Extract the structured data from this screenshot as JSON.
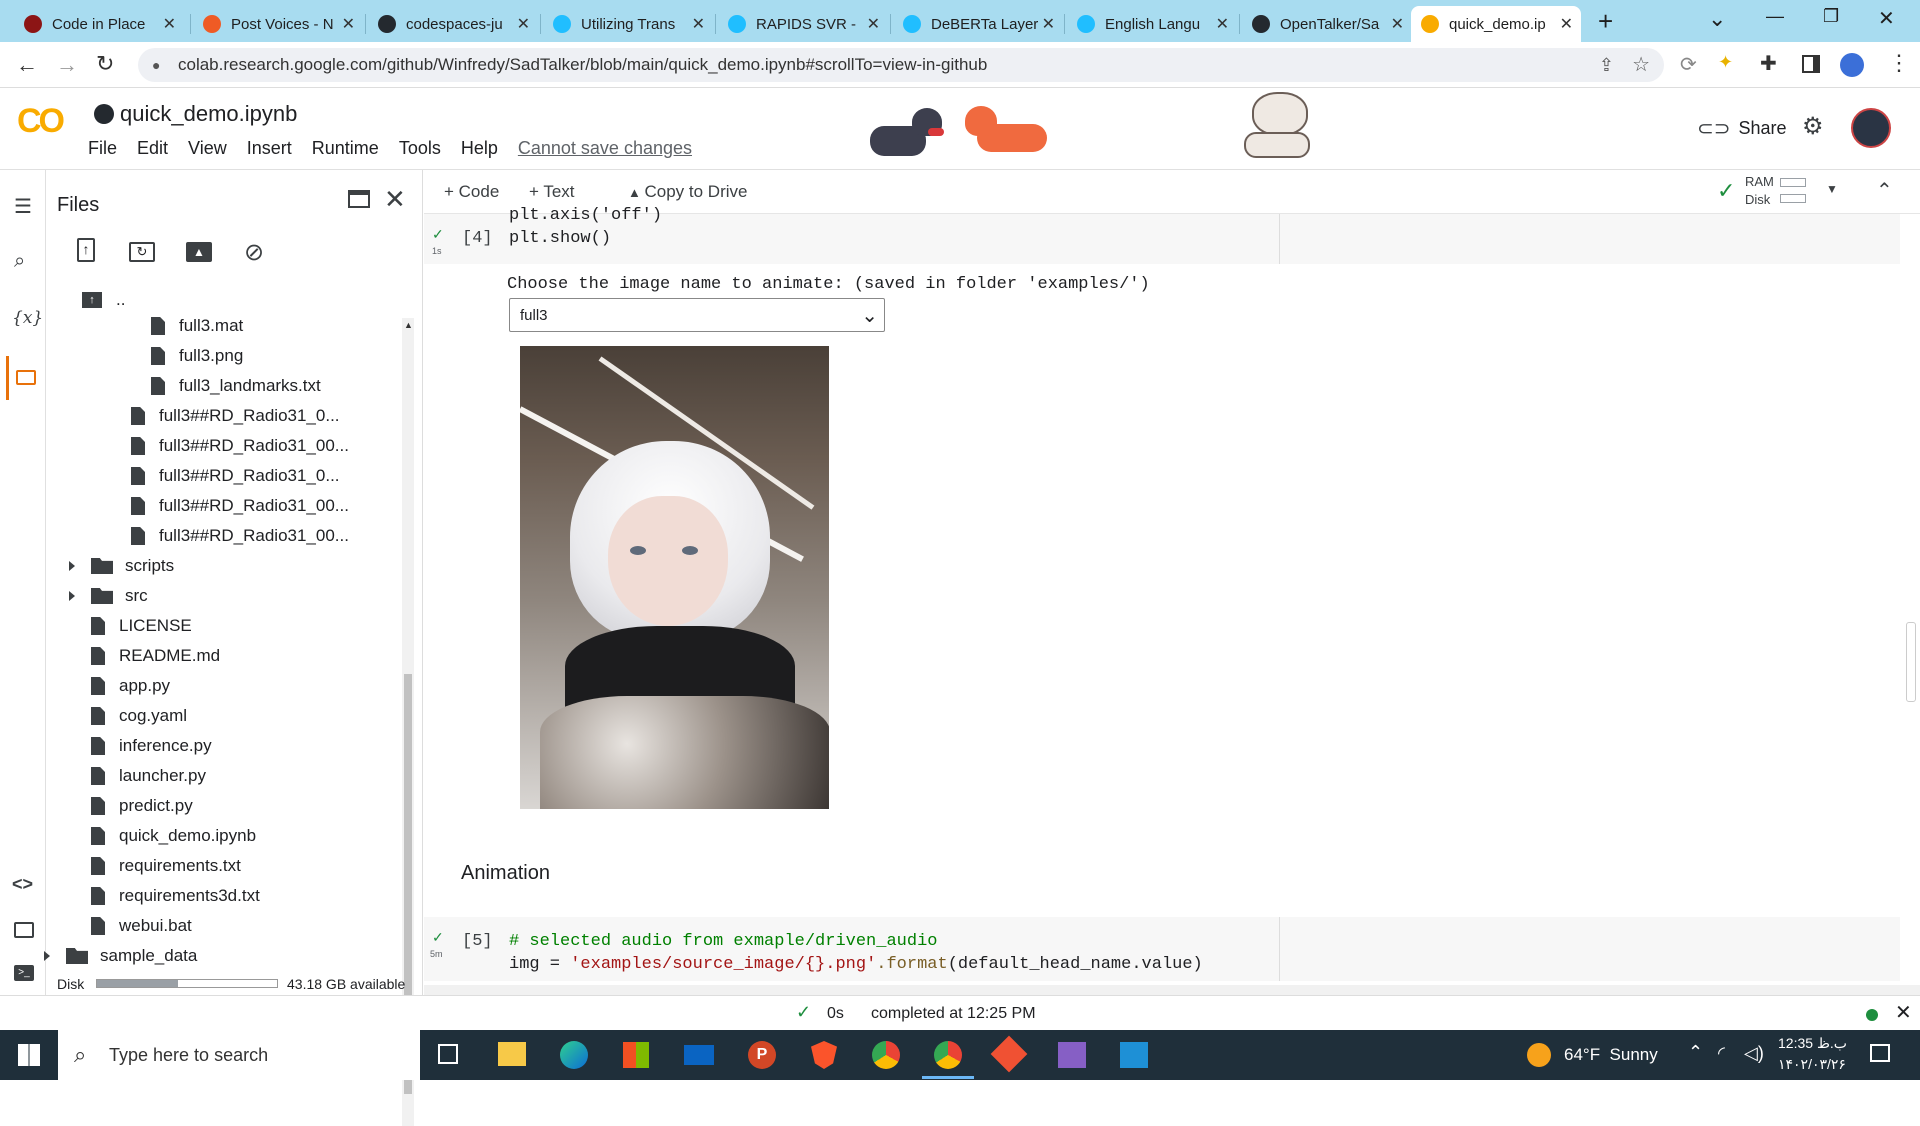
{
  "browser": {
    "tabs": [
      {
        "label": "Code in Place",
        "icon": "stanford-icon",
        "color": "#8c1515"
      },
      {
        "label": "Post Voices - N",
        "icon": "postman-icon",
        "color": "#ef5b25"
      },
      {
        "label": "codespaces-ju",
        "icon": "github-icon",
        "color": "#24292f"
      },
      {
        "label": "Utilizing Trans",
        "icon": "kaggle-icon",
        "color": "#20beff"
      },
      {
        "label": "RAPIDS SVR -",
        "icon": "kaggle-icon",
        "color": "#20beff"
      },
      {
        "label": "DeBERTa Layer",
        "icon": "kaggle-icon",
        "color": "#20beff"
      },
      {
        "label": "English Langu",
        "icon": "kaggle-icon",
        "color": "#20beff"
      },
      {
        "label": "OpenTalker/Sa",
        "icon": "github-icon",
        "color": "#24292f"
      },
      {
        "label": "quick_demo.ip",
        "icon": "colab-icon",
        "color": "#f9ab00"
      }
    ],
    "url": "colab.research.google.com/github/Winfredy/SadTalker/blob/main/quick_demo.ipynb#scrollTo=view-in-github"
  },
  "colab": {
    "logo": "CO",
    "notebook_title": "quick_demo.ipynb",
    "menu": [
      "File",
      "Edit",
      "View",
      "Insert",
      "Runtime",
      "Tools",
      "Help"
    ],
    "cannot_save": "Cannot save changes",
    "share": "Share"
  },
  "toolbar": {
    "code": "Code",
    "text": "Text",
    "copy_to_drive": "Copy to Drive",
    "ram": "RAM",
    "disk": "Disk"
  },
  "files_panel": {
    "title": "Files",
    "parent": "..",
    "items": [
      {
        "name": "full3.mat",
        "kind": "file",
        "level": 3
      },
      {
        "name": "full3.png",
        "kind": "file",
        "level": 3
      },
      {
        "name": "full3_landmarks.txt",
        "kind": "file",
        "level": 3
      },
      {
        "name": "full3##RD_Radio31_0...",
        "kind": "file",
        "level": 2
      },
      {
        "name": "full3##RD_Radio31_00...",
        "kind": "file",
        "level": 2
      },
      {
        "name": "full3##RD_Radio31_0...",
        "kind": "file",
        "level": 2
      },
      {
        "name": "full3##RD_Radio31_00...",
        "kind": "file",
        "level": 2
      },
      {
        "name": "full3##RD_Radio31_00...",
        "kind": "file",
        "level": 2
      },
      {
        "name": "scripts",
        "kind": "folder",
        "level": 1
      },
      {
        "name": "src",
        "kind": "folder",
        "level": 1
      },
      {
        "name": "LICENSE",
        "kind": "file",
        "level": 1
      },
      {
        "name": "README.md",
        "kind": "file",
        "level": 1
      },
      {
        "name": "app.py",
        "kind": "file",
        "level": 1
      },
      {
        "name": "cog.yaml",
        "kind": "file",
        "level": 1
      },
      {
        "name": "inference.py",
        "kind": "file",
        "level": 1
      },
      {
        "name": "launcher.py",
        "kind": "file",
        "level": 1
      },
      {
        "name": "predict.py",
        "kind": "file",
        "level": 1
      },
      {
        "name": "quick_demo.ipynb",
        "kind": "file",
        "level": 1
      },
      {
        "name": "requirements.txt",
        "kind": "file",
        "level": 1
      },
      {
        "name": "requirements3d.txt",
        "kind": "file",
        "level": 1
      },
      {
        "name": "webui.bat",
        "kind": "file",
        "level": 1
      },
      {
        "name": "sample_data",
        "kind": "folder",
        "level": 0
      }
    ],
    "disk_label": "Disk",
    "disk_available": "43.18 GB available",
    "disk_fraction": 0.45
  },
  "cells": {
    "cell4": {
      "exec_count": "[4]",
      "time": "1s",
      "line1": "plt.axis('off')",
      "line2": "plt.show()",
      "output_label": "Choose the image name to animate: (saved in folder 'examples/')",
      "dropdown_value": "full3"
    },
    "section_heading": "Animation",
    "cell5": {
      "exec_count": "[5]",
      "time": "5m",
      "comment": "# selected audio from exmaple/driven_audio",
      "line_img_a": "img = ",
      "line_img_str": "'examples/source_image/{}.png'",
      "line_img_b": ".format",
      "line_img_c": "(default_head_name.value)"
    }
  },
  "statusbar": {
    "duration": "0s",
    "completed": "completed at 12:25 PM"
  },
  "taskbar": {
    "search_placeholder": "Type here to search",
    "weather": "64°F  Sunny",
    "time": "12:35 ب.ظ",
    "date": "۱۴۰۲/۰۳/۲۶"
  }
}
